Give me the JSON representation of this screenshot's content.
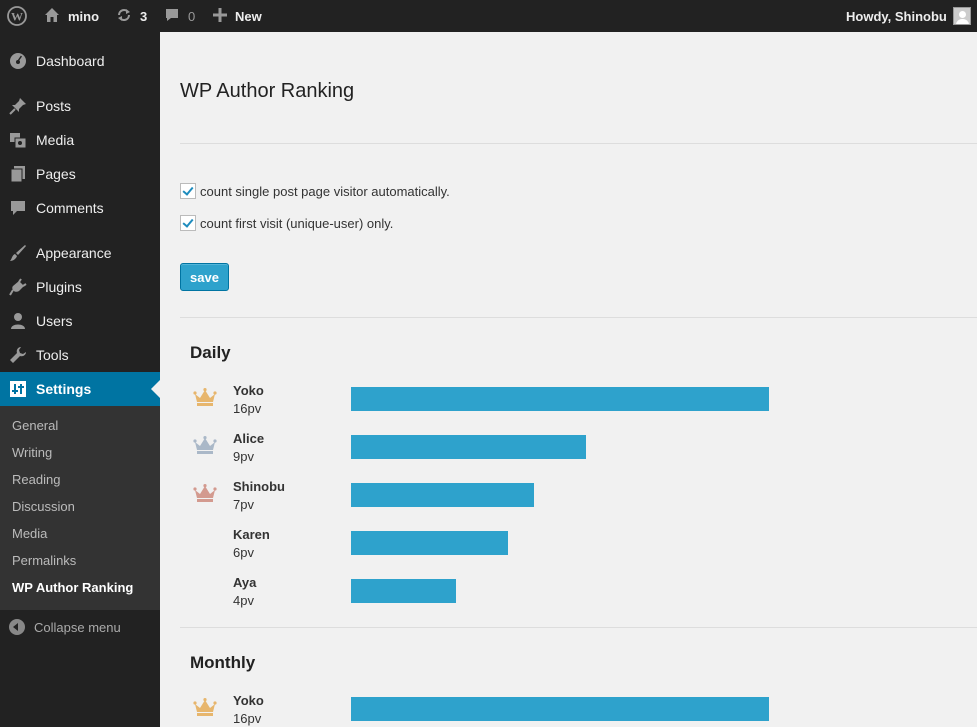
{
  "adminbar": {
    "site_name": "mino",
    "updates_count": "3",
    "comments_count": "0",
    "new_label": "New",
    "greeting": "Howdy, Shinobu"
  },
  "sidebar": {
    "items": [
      {
        "label": "Dashboard",
        "icon": "dashboard-icon"
      },
      {
        "label": "Posts",
        "icon": "pin-icon"
      },
      {
        "label": "Media",
        "icon": "media-icon"
      },
      {
        "label": "Pages",
        "icon": "pages-icon"
      },
      {
        "label": "Comments",
        "icon": "comment-icon"
      },
      {
        "label": "Appearance",
        "icon": "brush-icon"
      },
      {
        "label": "Plugins",
        "icon": "plug-icon"
      },
      {
        "label": "Users",
        "icon": "user-icon"
      },
      {
        "label": "Tools",
        "icon": "wrench-icon"
      },
      {
        "label": "Settings",
        "icon": "settings-icon"
      }
    ],
    "submenu": [
      "General",
      "Writing",
      "Reading",
      "Discussion",
      "Media",
      "Permalinks",
      "WP Author Ranking"
    ],
    "collapse_label": "Collapse menu"
  },
  "main": {
    "title": "WP Author Ranking",
    "option_auto_count": "count single post page visitor automatically.",
    "option_unique": "count first visit (unique-user) only.",
    "save_label": "save",
    "daily": {
      "title": "Daily",
      "rows": [
        {
          "name": "Yoko",
          "pv": "16pv",
          "count": 16
        },
        {
          "name": "Alice",
          "pv": "9pv",
          "count": 9
        },
        {
          "name": "Shinobu",
          "pv": "7pv",
          "count": 7
        },
        {
          "name": "Karen",
          "pv": "6pv",
          "count": 6
        },
        {
          "name": "Aya",
          "pv": "4pv",
          "count": 4
        }
      ]
    },
    "monthly": {
      "title": "Monthly",
      "rows": [
        {
          "name": "Yoko",
          "pv": "16pv",
          "count": 16
        }
      ]
    }
  },
  "colors": {
    "accent": "#2ea2cc",
    "gold": "#e7b66d",
    "silver": "#aab8c8",
    "bronze": "#d39a8f"
  }
}
